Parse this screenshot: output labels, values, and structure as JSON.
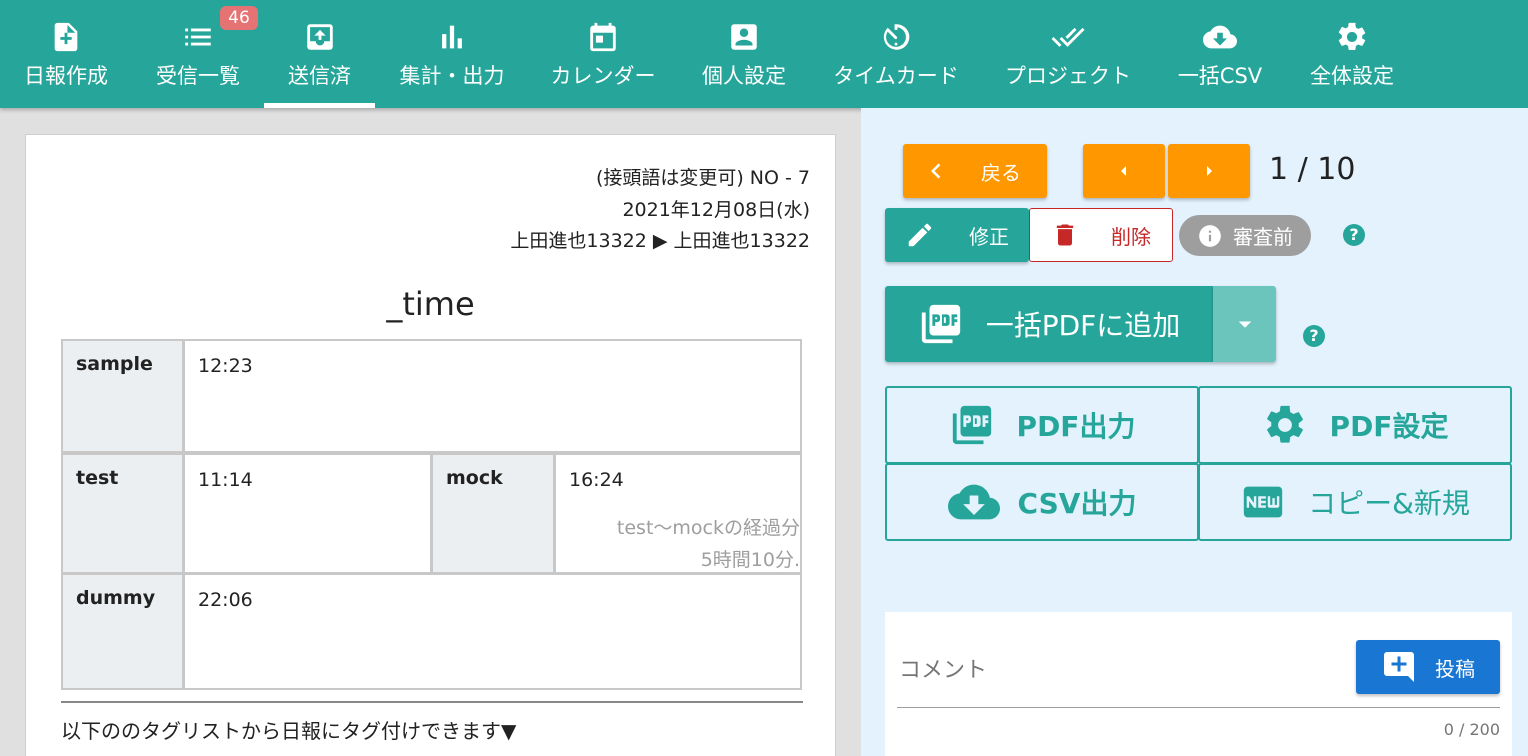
{
  "nav": {
    "items": [
      {
        "label": "日報作成",
        "icon": "file-plus-icon"
      },
      {
        "label": "受信一覧",
        "icon": "list-icon",
        "badge": "46"
      },
      {
        "label": "送信済",
        "icon": "outbox-icon",
        "active": true
      },
      {
        "label": "集計・出力",
        "icon": "bar-chart-icon"
      },
      {
        "label": "カレンダー",
        "icon": "calendar-icon"
      },
      {
        "label": "個人設定",
        "icon": "account-box-icon"
      },
      {
        "label": "タイムカード",
        "icon": "timer-icon"
      },
      {
        "label": "プロジェクト",
        "icon": "double-check-icon"
      },
      {
        "label": "一括CSV",
        "icon": "cloud-download-icon"
      },
      {
        "label": "全体設定",
        "icon": "gear-icon"
      }
    ]
  },
  "report": {
    "number_line": "(接頭語は変更可) NO - 7",
    "date": "2021年12月08日(水)",
    "route": "上田進也13322 ▶ 上田進也13322",
    "title": "_time",
    "rows": {
      "sample_key": "sample",
      "sample_val": "12:23",
      "test_key": "test",
      "test_val": "11:14",
      "mock_key": "mock",
      "mock_val": "16:24",
      "mock_note1": "test〜mockの経過分",
      "mock_note2": "5時間10分.",
      "dummy_key": "dummy",
      "dummy_val": "22:06"
    },
    "tag_hint": "以下ののタグリストから日報にタグ付けできます▼"
  },
  "actions": {
    "back_label": "戻る",
    "page_indicator": "1 / 10",
    "edit_label": "修正",
    "delete_label": "削除",
    "status_label": "審査前",
    "add_pdf_label": "一括PDFに追加",
    "pdf_output_label": "PDF出力",
    "pdf_settings_label": "PDF設定",
    "csv_output_label": "CSV出力",
    "copy_new_label": "コピー&新規",
    "help_mark": "?"
  },
  "comment": {
    "placeholder": "コメント",
    "post_label": "投稿",
    "counter": "0 / 200"
  },
  "colors": {
    "nav_bg": "#26a69a",
    "orange": "#ff9800",
    "delete_red": "#c62828",
    "panel_bg": "#e3f2fd",
    "post_blue": "#1976d2",
    "badge_red": "#e57373"
  }
}
